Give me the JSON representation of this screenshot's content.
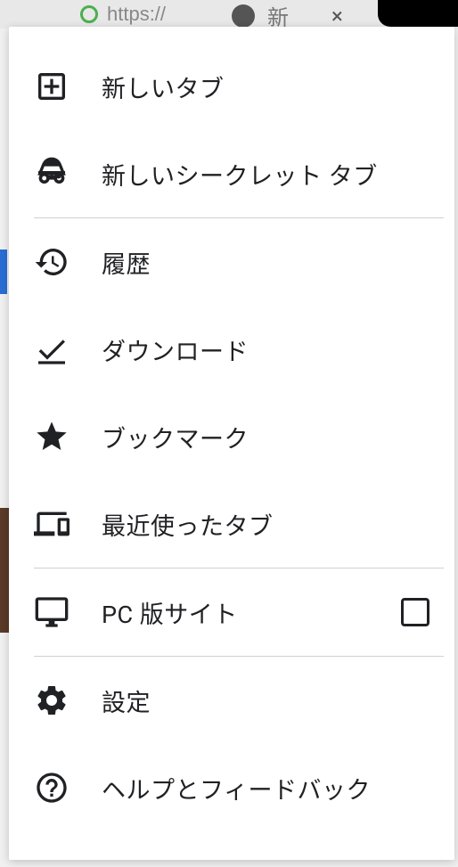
{
  "background": {
    "url_text": "https://",
    "tab_text": "新",
    "close": "×"
  },
  "menu": {
    "new_tab": "新しいタブ",
    "new_incognito": "新しいシークレット タブ",
    "history": "履歴",
    "downloads": "ダウンロード",
    "bookmarks": "ブックマーク",
    "recent_tabs": "最近使ったタブ",
    "desktop_site": "PC 版サイト",
    "settings": "設定",
    "help_feedback": "ヘルプとフィードバック"
  }
}
